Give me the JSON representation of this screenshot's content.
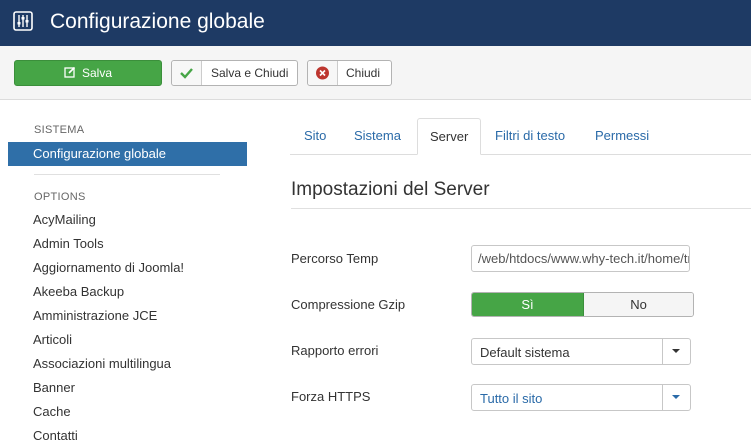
{
  "header": {
    "title": "Configurazione globale",
    "icon": "sliders-icon",
    "background": "#1e3a64"
  },
  "toolbar": {
    "save_label": "Salva",
    "save_close_label": "Salva e Chiudi",
    "close_label": "Chiudi",
    "save_color": "#46a546",
    "icons": {
      "save": "edit-icon",
      "save_close": "check-icon",
      "close": "cancel-icon"
    }
  },
  "sidebar": {
    "system_heading": "SISTEMA",
    "active_item": "Configurazione globale",
    "options_heading": "OPTIONS",
    "items": [
      "AcyMailing",
      "Admin Tools",
      "Aggiornamento di Joomla!",
      "Akeeba Backup",
      "Amministrazione JCE",
      "Articoli",
      "Associazioni multilingua",
      "Banner",
      "Cache",
      "Contatti"
    ],
    "active_color": "#2f6fa8"
  },
  "tabs": [
    {
      "label": "Sito",
      "active": false
    },
    {
      "label": "Sistema",
      "active": false
    },
    {
      "label": "Server",
      "active": true
    },
    {
      "label": "Filtri di testo",
      "active": false
    },
    {
      "label": "Permessi",
      "active": false
    }
  ],
  "main": {
    "section_title": "Impostazioni del Server",
    "fields": {
      "temp_path": {
        "label": "Percorso Temp",
        "value": "/web/htdocs/www.why-tech.it/home/tmp"
      },
      "gzip": {
        "label": "Compressione Gzip",
        "yes": "Sì",
        "no": "No",
        "selected": "Sì"
      },
      "error_reporting": {
        "label": "Rapporto errori",
        "value": "Default sistema"
      },
      "force_https": {
        "label": "Forza HTTPS",
        "value": "Tutto il sito",
        "value_color": "#2a6aa8"
      }
    }
  }
}
